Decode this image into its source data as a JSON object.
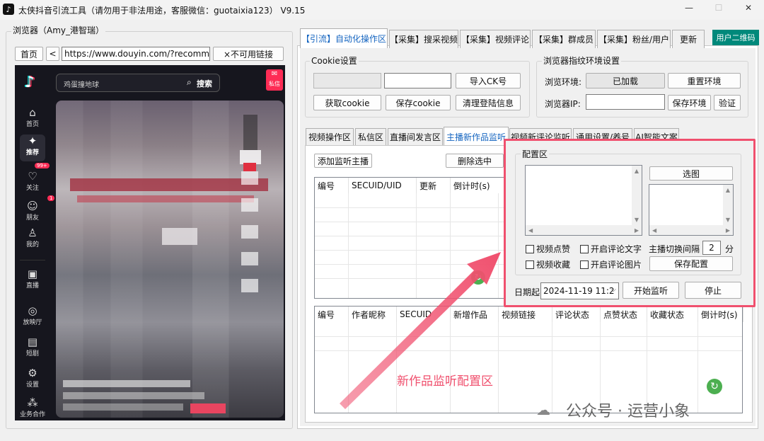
{
  "window": {
    "title": "太侠抖音引流工具（请勿用于非法用途，客服微信：guotaixia123）  V9.15",
    "app_icon": "douyin-logo-icon",
    "controls": [
      "—",
      "☐",
      "✕"
    ]
  },
  "browser_panel": {
    "title": "浏览器（Amy_港智瑞）",
    "home_label": "首页",
    "back_label": "<",
    "url": "https://www.douyin.com/?recommend",
    "unavailable_label": "×不可用链接"
  },
  "douyin": {
    "search_placeholder": "鸡蛋撞地球",
    "search_button": "搜索",
    "dm_label": "私信",
    "badge_follow": "99+",
    "badge_friends": "1",
    "sidebar": [
      {
        "icon": "home-icon",
        "glyph": "⌂",
        "label": "首页"
      },
      {
        "icon": "recommend-icon",
        "glyph": "✦",
        "label": "推荐"
      },
      {
        "icon": "follow-icon",
        "glyph": "♡",
        "label": "关注"
      },
      {
        "icon": "friends-icon",
        "glyph": "☺",
        "label": "朋友"
      },
      {
        "icon": "me-icon",
        "glyph": "♙",
        "label": "我的"
      },
      {
        "icon": "live-icon",
        "glyph": "▣",
        "label": "直播"
      },
      {
        "icon": "hall-icon",
        "glyph": "◎",
        "label": "放映厅"
      },
      {
        "icon": "short-drama-icon",
        "glyph": "▤",
        "label": "短剧"
      },
      {
        "icon": "settings-icon",
        "glyph": "⚙",
        "label": "设置"
      },
      {
        "icon": "business-icon",
        "glyph": "⁂",
        "label": "业务合作"
      }
    ]
  },
  "top_tabs": [
    "【引流】自动化操作区",
    "【采集】搜采视频",
    "【采集】视频评论",
    "【采集】群成员",
    "【采集】粉丝/用户",
    "更新"
  ],
  "qr_button": "用户二维码",
  "cookie": {
    "title": "Cookie设置",
    "import_button": "导入CK号",
    "get_button": "获取cookie",
    "save_button": "保存cookie",
    "clear_button": "清理登陆信息"
  },
  "fingerprint": {
    "title": "浏览器指纹环境设置",
    "env_label": "浏览环境:",
    "env_status": "已加载",
    "reset_button": "重置环境",
    "ip_label": "浏览器IP:",
    "save_button": "保存环境",
    "verify_button": "验证"
  },
  "sub_tabs": [
    "视频操作区",
    "私信区",
    "直播间发言区",
    "主播新作品监听",
    "视频新评论监听",
    "通用设置/养号",
    "AI智能文案"
  ],
  "monitor": {
    "add_button": "添加监听主播",
    "delete_button": "删除选中",
    "table1_columns": [
      "编号",
      "SECUID/UID",
      "更新",
      "倒计时(s)"
    ],
    "table2_columns": [
      "编号",
      "作者昵称",
      "SECUID",
      "新增作品",
      "视频链接",
      "评论状态",
      "点赞状态",
      "收藏状态",
      "倒计时(s)"
    ]
  },
  "config": {
    "title": "配置区",
    "select_image_button": "选图",
    "like_video": "视频点赞",
    "open_comment_text": "开启评论文字",
    "collect_video": "视频收藏",
    "open_comment_image": "开启评论图片",
    "switch_interval_label": "主播切换间隔",
    "switch_interval_value": "2",
    "switch_interval_unit": "分",
    "save_button": "保存配置",
    "date_label": "日期起",
    "date_value": "2024-11-19 11:2",
    "start_button": "开始监听",
    "stop_button": "停止"
  },
  "annotation": {
    "text": "新作品监听配置区",
    "color": "#f0506e"
  },
  "watermark": {
    "text": "公众号 · 运营小象"
  },
  "colors": {
    "accent_tab": "#1565c0",
    "qr_bg": "#00897b",
    "highlight": "#f0506e",
    "refresh_green": "#4caf50"
  }
}
